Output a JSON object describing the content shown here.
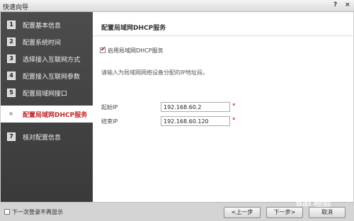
{
  "window": {
    "title": "快速向导",
    "help_glyph": "?",
    "close_glyph": "×"
  },
  "sidebar": {
    "items": [
      {
        "num": "1",
        "label": "配置基本信息",
        "active": false
      },
      {
        "num": "2",
        "label": "配置系统时间",
        "active": false
      },
      {
        "num": "3",
        "label": "选择接入互联网方式",
        "active": false
      },
      {
        "num": "4",
        "label": "配置接入互联网参数",
        "active": false
      },
      {
        "num": "5",
        "label": "配置局域网接口",
        "active": false
      },
      {
        "num": "",
        "label": "配置局域网DHCP服务",
        "active": true
      },
      {
        "num": "7",
        "label": "核对配置信息",
        "active": false
      }
    ]
  },
  "main": {
    "heading": "配置局域网DHCP服务",
    "enable_dhcp": {
      "label": "启用局域网DHCP服务",
      "checked": true
    },
    "info_text": "请输入为局域网网络设备分配的IP地址段。",
    "start_ip": {
      "label": "起始IP",
      "value": "192.168.60.2"
    },
    "end_ip": {
      "label": "结束IP",
      "value": "192.168.60.120"
    },
    "required_mark": "*"
  },
  "footer": {
    "dont_show_label": "下一次登录不再显示",
    "prev_label": "<上一步",
    "next_label": "下一步>",
    "cancel_label": "取消"
  },
  "watermark": "Bai 经验"
}
